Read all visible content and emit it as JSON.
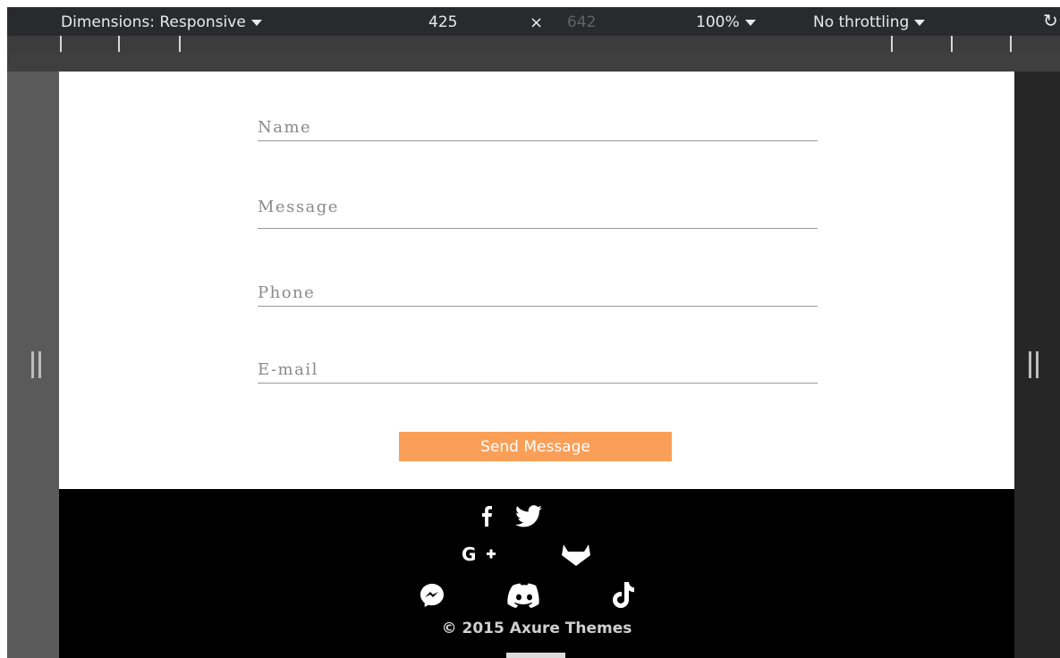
{
  "devtools": {
    "dimensions_label": "Dimensions: Responsive",
    "width_value": "425",
    "times_symbol": "×",
    "height_value": "642",
    "zoom_label": "100%",
    "throttle_label": "No throttling"
  },
  "form": {
    "name_placeholder": "Name",
    "message_placeholder": "Message",
    "phone_placeholder": "Phone",
    "email_placeholder": "E-mail",
    "send_label": "Send Message"
  },
  "footer": {
    "social_icons": [
      "facebook-icon",
      "twitter-icon",
      "google-plus-icon",
      "gitlab-icon",
      "messenger-icon",
      "discord-icon",
      "tiktok-icon"
    ],
    "copyright": "© 2015 Axure Themes"
  },
  "colors": {
    "accent": "#fa9f58",
    "footer_bg": "#000000",
    "toolbar_bg": "#292a2d"
  }
}
